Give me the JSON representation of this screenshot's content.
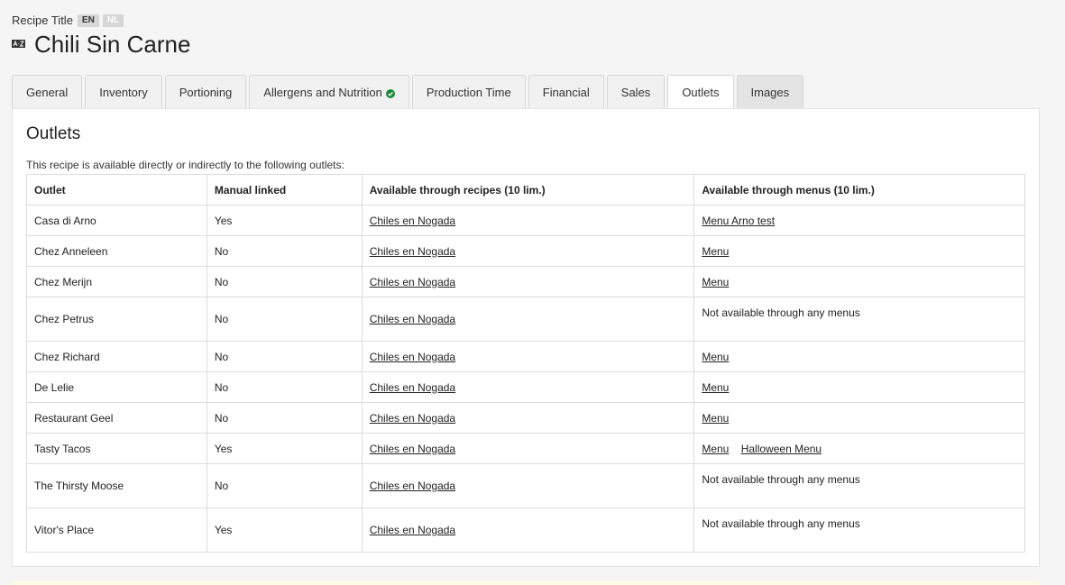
{
  "header": {
    "title_label": "Recipe Title",
    "languages": [
      "EN",
      "NL"
    ],
    "recipe_title": "Chili Sin Carne"
  },
  "tabs": [
    {
      "label": "General"
    },
    {
      "label": "Inventory"
    },
    {
      "label": "Portioning"
    },
    {
      "label": "Allergens and Nutrition"
    },
    {
      "label": "Production Time"
    },
    {
      "label": "Financial"
    },
    {
      "label": "Sales"
    },
    {
      "label": "Outlets"
    },
    {
      "label": "Images"
    }
  ],
  "colors": {
    "check": "#1e8a3e",
    "panel": "#ffffff",
    "background": "#f5f5f5"
  },
  "outlets": {
    "title": "Outlets",
    "intro": "This recipe is available directly or indirectly to the following outlets:",
    "columns": [
      "Outlet",
      "Manual linked",
      "Available through recipes (10 lim.)",
      "Available through menus (10 lim.)"
    ],
    "rows": [
      {
        "outlet": "Casa di Arno",
        "manual": "Yes",
        "recipes": [
          "Chiles en Nogada"
        ],
        "menus": [
          "Menu Arno test"
        ]
      },
      {
        "outlet": "Chez Anneleen",
        "manual": "No",
        "recipes": [
          "Chiles en Nogada"
        ],
        "menus": [
          "Menu"
        ]
      },
      {
        "outlet": "Chez Merijn",
        "manual": "No",
        "recipes": [
          "Chiles en Nogada"
        ],
        "menus": [
          "Menu"
        ]
      },
      {
        "outlet": "Chez Petrus",
        "manual": "No",
        "recipes": [
          "Chiles en Nogada"
        ],
        "menus_text": "Not available through any menus"
      },
      {
        "outlet": "Chez Richard",
        "manual": "No",
        "recipes": [
          "Chiles en Nogada"
        ],
        "menus": [
          "Menu"
        ]
      },
      {
        "outlet": "De Lelie",
        "manual": "No",
        "recipes": [
          "Chiles en Nogada"
        ],
        "menus": [
          "Menu"
        ]
      },
      {
        "outlet": "Restaurant Geel",
        "manual": "No",
        "recipes": [
          "Chiles en Nogada"
        ],
        "menus": [
          "Menu"
        ]
      },
      {
        "outlet": "Tasty Tacos",
        "manual": "Yes",
        "recipes": [
          "Chiles en Nogada"
        ],
        "menus": [
          "Menu",
          "Halloween Menu"
        ]
      },
      {
        "outlet": "The Thirsty Moose",
        "manual": "No",
        "recipes": [
          "Chiles en Nogada"
        ],
        "menus_text": "Not available through any menus"
      },
      {
        "outlet": "Vitor's Place",
        "manual": "Yes",
        "recipes": [
          "Chiles en Nogada"
        ],
        "menus_text": "Not available through any menus"
      }
    ]
  }
}
